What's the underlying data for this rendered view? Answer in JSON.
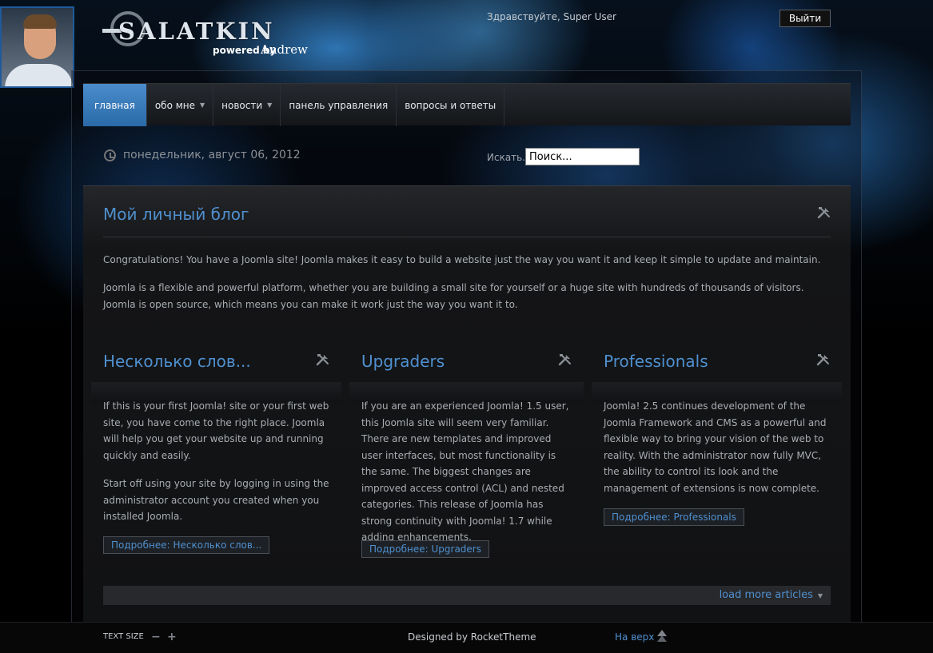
{
  "header": {
    "greeting": "Здравствуйте, Super User",
    "logout_label": "Выйти",
    "logo_text": "SALATKIN",
    "logo_powered": "powered by",
    "logo_author": "Andrew"
  },
  "nav": {
    "items": [
      {
        "label": "главная",
        "active": true
      },
      {
        "label": "обо мне",
        "dropdown": true
      },
      {
        "label": "новости",
        "dropdown": true
      },
      {
        "label": "панель управления"
      },
      {
        "label": "вопросы и ответы"
      }
    ]
  },
  "date_bar": {
    "date": "понедельник, август 06, 2012",
    "search_label": "Искать...",
    "search_value": "Поиск..."
  },
  "lead_article": {
    "title": "Мой личный блог",
    "paragraphs": [
      "Congratulations! You have a Joomla site! Joomla makes it easy to build a website just the way you want it and keep it simple to update and maintain.",
      "Joomla is a flexible and powerful platform, whether you are building a small site for yourself or a huge site with hundreds of thousands of visitors. Joomla is open source, which means you can make it work just the way you want it to."
    ]
  },
  "columns": [
    {
      "title": "Несколько слов...",
      "paragraphs": [
        "If this is your first Joomla! site or your first web site, you have come to the right place. Joomla will help you get your website up and running quickly and easily.",
        "Start off using your site by logging in using the administrator account you created when you installed Joomla."
      ],
      "read_more": "Подробнее: Несколько слов..."
    },
    {
      "title": "Upgraders",
      "paragraphs": [
        "If you are an experienced Joomla! 1.5 user, this Joomla site will seem very familiar. There are new templates and improved user interfaces, but most functionality is the same. The biggest changes are improved access control (ACL) and nested categories. This release of Joomla has strong continuity with Joomla! 1.7 while adding enhancements."
      ],
      "read_more": "Подробнее: Upgraders"
    },
    {
      "title": "Professionals",
      "paragraphs": [
        "Joomla! 2.5 continues development of the Joomla Framework and CMS as a powerful and flexible way to bring your vision of the web to reality. With the administrator now fully MVC, the ability to control its look and the management of extensions is now complete."
      ],
      "read_more": "Подробнее: Professionals"
    }
  ],
  "load_more": "load more articles",
  "footer": {
    "text_size_label": "TEXT SIZE",
    "designed_by": "Designed by RocketTheme",
    "to_top": "На верх"
  },
  "colors": {
    "accent": "#4f90cf",
    "nav_active": "#3a7cbc"
  },
  "icons": [
    "clock-icon",
    "tools-icon",
    "minus-icon",
    "plus-icon",
    "arrow-up-icon",
    "dropdown-arrow-icon"
  ]
}
